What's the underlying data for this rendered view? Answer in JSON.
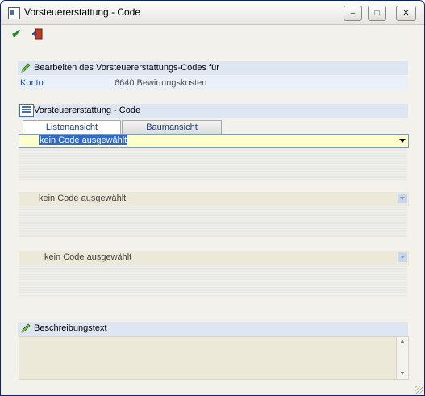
{
  "window": {
    "title": "Vorsteuererstattung - Code",
    "min_label": "‒",
    "max_label": "□",
    "close_label": "✕"
  },
  "toolbar": {
    "ok_icon": "checkmark-icon",
    "exit_icon": "exit-door-icon",
    "ok_glyph": "✔"
  },
  "edit_section": {
    "title": "Bearbeiten des Vorsteuererstattungs-Codes für",
    "konto_label": "Konto",
    "konto_value": "6640 Bewirtungskosten"
  },
  "code_section": {
    "title": "Vorsteuererstattung - Code",
    "tabs": [
      {
        "label": "Listenansicht",
        "active": true
      },
      {
        "label": "Baumansicht",
        "active": false
      }
    ],
    "combos": [
      {
        "value": "kein Code ausgewählt",
        "state": "active"
      },
      {
        "value": "kein Code ausgewählt",
        "state": "disabled"
      },
      {
        "value": "kein Code ausgewählt",
        "state": "disabled"
      }
    ]
  },
  "description_section": {
    "title": "Beschreibungstext",
    "text": ""
  },
  "colors": {
    "accent": "#316ac5",
    "section_bar": "#dfe6f3",
    "active_combo": "#ffffcc"
  }
}
